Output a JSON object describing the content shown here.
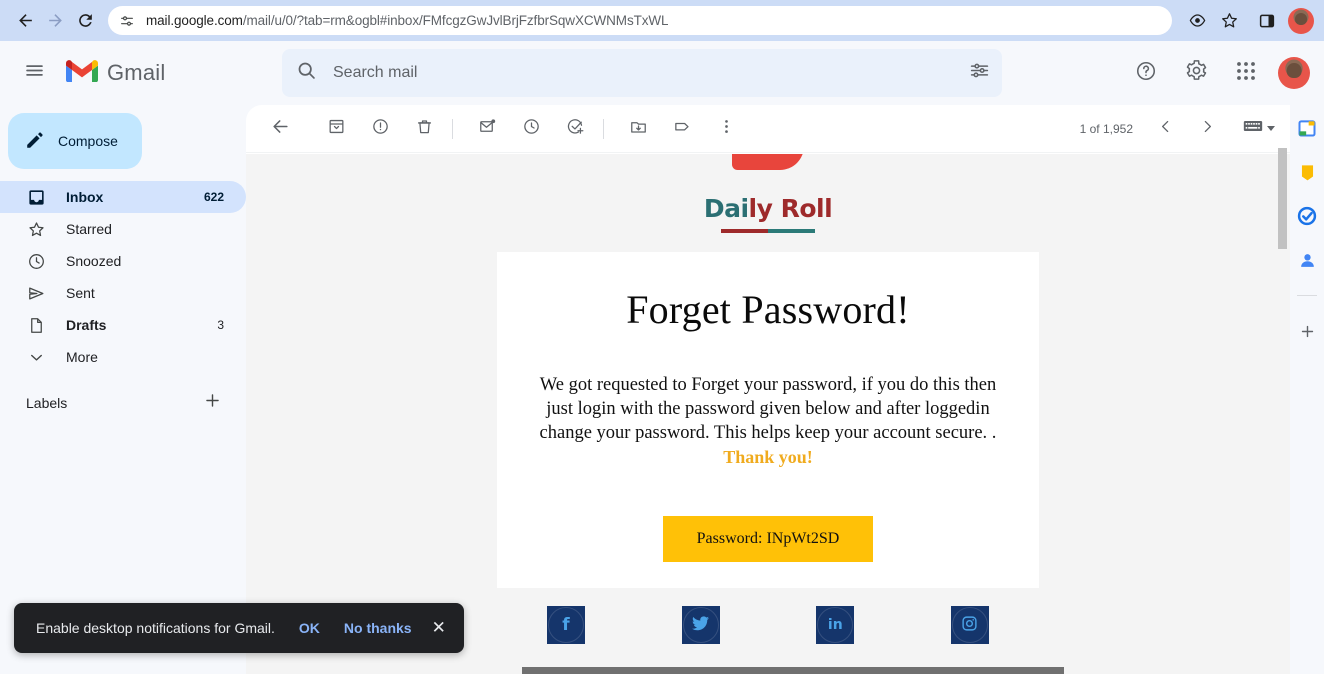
{
  "browser": {
    "url_main": "mail.google.com",
    "url_rest": "/mail/u/0/?tab=rm&ogbl#inbox/FMfcgzGwJvlBrjFzfbrSqwXCWNMsTxWL",
    "back_icon": "back-arrow-icon",
    "forward_icon": "forward-arrow-icon",
    "reload_icon": "reload-icon",
    "site_settings_icon": "site-settings-icon",
    "tracking_icon": "tracking-protection-icon",
    "bookmark_icon": "star-bookmark-icon",
    "sidepanel_icon": "side-panel-icon",
    "profile_icon": "profile-avatar"
  },
  "gmail_header": {
    "menu_icon": "hamburger-menu-icon",
    "logo_icon": "gmail-logo-icon",
    "app_name": "Gmail",
    "search": {
      "placeholder": "Search mail",
      "value": "",
      "search_icon": "search-icon",
      "options_icon": "search-options-icon"
    },
    "support_icon": "help-icon",
    "settings_icon": "gear-icon",
    "apps_icon": "google-apps-grid-icon",
    "account_icon": "account-avatar"
  },
  "sidebar": {
    "compose": {
      "label": "Compose",
      "icon": "pencil-compose-icon"
    },
    "items": [
      {
        "label": "Inbox",
        "count": "622",
        "icon": "inbox-icon",
        "active": true,
        "bold": true
      },
      {
        "label": "Starred",
        "count": "",
        "icon": "star-icon",
        "active": false,
        "bold": false
      },
      {
        "label": "Snoozed",
        "count": "",
        "icon": "clock-icon",
        "active": false,
        "bold": false
      },
      {
        "label": "Sent",
        "count": "",
        "icon": "send-icon",
        "active": false,
        "bold": false
      },
      {
        "label": "Drafts",
        "count": "3",
        "icon": "draft-icon",
        "active": false,
        "bold": true
      },
      {
        "label": "More",
        "count": "",
        "icon": "chevron-down-icon",
        "active": false,
        "bold": false
      }
    ],
    "labels": {
      "title": "Labels",
      "add_icon": "add-label-plus-icon"
    }
  },
  "mail_toolbar": {
    "back_icon": "back-to-inbox-icon",
    "archive_icon": "archive-icon",
    "spam_icon": "report-spam-icon",
    "delete_icon": "delete-trash-icon",
    "unread_icon": "mark-as-unread-icon",
    "snooze_icon": "snooze-clock-icon",
    "tasks_icon": "add-to-tasks-icon",
    "move_icon": "move-to-folder-icon",
    "label_icon": "label-tag-icon",
    "more_icon": "more-options-icon",
    "page_count": "1 of 1,952",
    "prev_icon": "previous-chevron-icon",
    "next_icon": "next-chevron-icon",
    "keyboard_icon": "keyboard-input-tools-icon",
    "keyboard_caret_icon": "caret-down-icon"
  },
  "email": {
    "brand": {
      "logo_icon": "red-swoosh-logo-icon",
      "name_part1": "Dai",
      "name_part2": "ly Roll"
    },
    "title": "Forget Password!",
    "body": "We got requested to Forget your password, if you do this then just login with the password given below and after loggedin change your password. This helps keep your account secure. .",
    "thanks": "Thank you!",
    "password_button": "Password: INpWt2SD",
    "social": [
      {
        "name": "facebook-icon",
        "glyph": "f"
      },
      {
        "name": "twitter-icon",
        "glyph": "🐦"
      },
      {
        "name": "linkedin-icon",
        "glyph": "in"
      },
      {
        "name": "instagram-icon",
        "glyph": "◎"
      }
    ]
  },
  "addon_panel": {
    "calendar_icon": "google-calendar-icon",
    "keep_icon": "google-keep-icon",
    "tasks_icon": "google-tasks-icon",
    "contacts_icon": "google-contacts-icon",
    "addons_icon": "get-addons-plus-icon"
  },
  "toast": {
    "message": "Enable desktop notifications for Gmail.",
    "ok_label": "OK",
    "dismiss_label": "No thanks",
    "close_icon": "close-icon"
  },
  "colors": {
    "chrome_bar": "#ccdcf6",
    "gmail_bg": "#f6f8fc",
    "accent_blue": "#c2e7ff",
    "active_nav": "#d3e3fd",
    "button_yellow": "#ffc107",
    "thanks_yellow": "#f0ab1e",
    "social_navy": "#15356b",
    "toast_bg": "#202124",
    "toast_link": "#8ab4f8"
  }
}
